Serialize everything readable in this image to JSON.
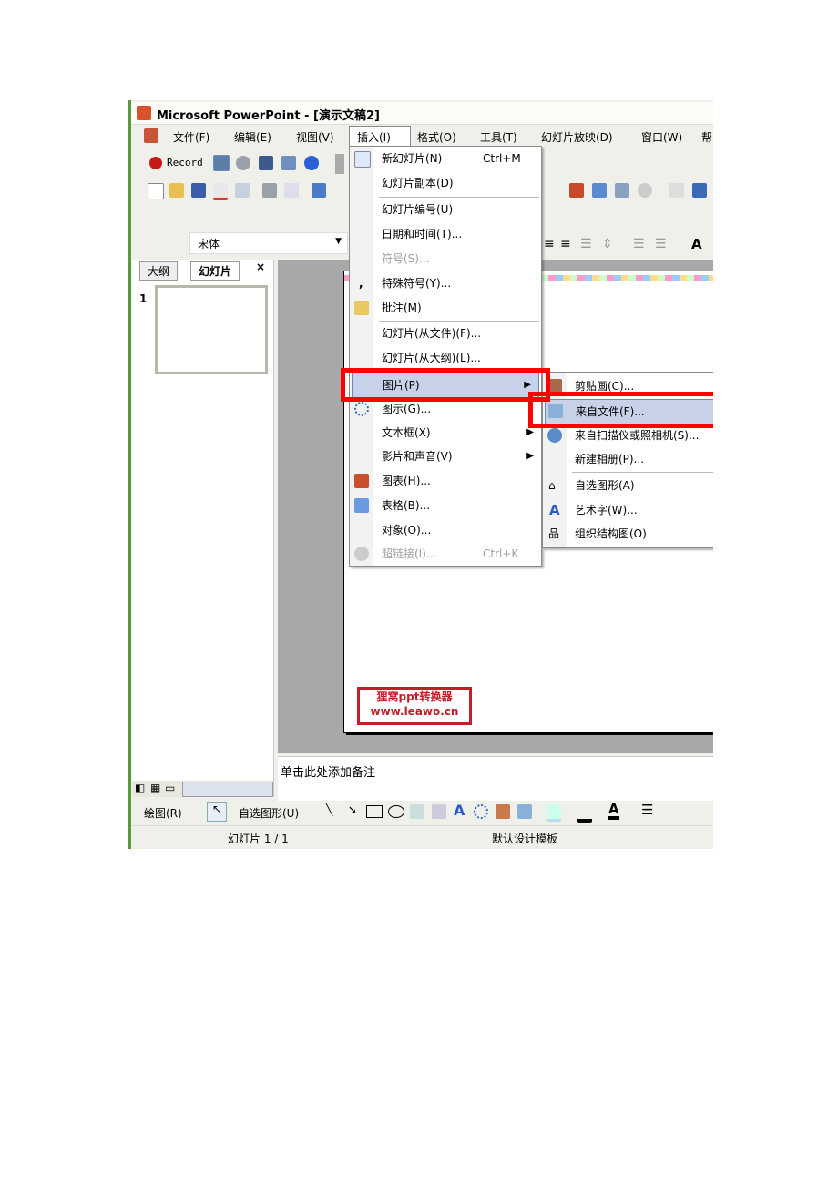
{
  "window": {
    "title": "Microsoft PowerPoint - [演示文稿2]"
  },
  "menubar": [
    "文件(F)",
    "编辑(E)",
    "视图(V)",
    "插入(I)",
    "格式(O)",
    "工具(T)",
    "幻灯片放映(D)",
    "窗口(W)",
    "帮"
  ],
  "toolbar": {
    "record_label": "Record",
    "font_name": "宋体"
  },
  "left_panel": {
    "tabs": [
      "大纲",
      "幻灯片"
    ],
    "close": "×",
    "slide_number": "1"
  },
  "insert_menu": [
    {
      "label": "新幻灯片(N)",
      "shortcut": "Ctrl+M"
    },
    {
      "label": "幻灯片副本(D)"
    },
    {
      "label": "幻灯片编号(U)"
    },
    {
      "label": "日期和时间(T)..."
    },
    {
      "label": "符号(S)...",
      "disabled": true
    },
    {
      "label": "特殊符号(Y)..."
    },
    {
      "label": "批注(M)"
    },
    {
      "label": "幻灯片(从文件)(F)..."
    },
    {
      "label": "幻灯片(从大纲)(L)..."
    },
    {
      "label": "图片(P)",
      "submenu": true,
      "highlighted": true
    },
    {
      "label": "图示(G)..."
    },
    {
      "label": "文本框(X)",
      "submenu": true
    },
    {
      "label": "影片和声音(V)",
      "submenu": true
    },
    {
      "label": "图表(H)..."
    },
    {
      "label": "表格(B)..."
    },
    {
      "label": "对象(O)..."
    },
    {
      "label": "超链接(I)...",
      "shortcut": "Ctrl+K",
      "disabled": true
    }
  ],
  "picture_submenu": [
    {
      "label": "剪贴画(C)..."
    },
    {
      "label": "来自文件(F)...",
      "highlighted": true
    },
    {
      "label": "来自扫描仪或照相机(S)..."
    },
    {
      "label": "新建相册(P)..."
    },
    {
      "label": "自选图形(A)"
    },
    {
      "label": "艺术字(W)..."
    },
    {
      "label": "组织结构图(O)"
    }
  ],
  "slide": {
    "watermark_line1": "狸窝ppt转换器",
    "watermark_line2": "www.leawo.cn"
  },
  "notes": {
    "placeholder": "单击此处添加备注"
  },
  "drawing_toolbar": {
    "draw_label": "绘图(R)",
    "autoshapes_label": "自选图形(U)"
  },
  "status": {
    "slide": "幻灯片 1 / 1",
    "template": "默认设计模板"
  },
  "colors": {
    "highlight_outline": "#ff0000",
    "menu_highlight": "#c7d2e8"
  }
}
